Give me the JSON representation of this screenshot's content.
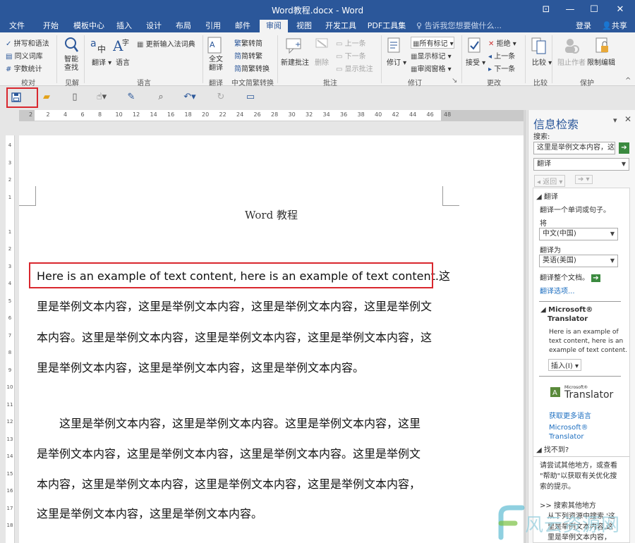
{
  "window": {
    "title": "Word教程.docx - Word",
    "controls": [
      "⊡",
      "—",
      "☐",
      "✕"
    ]
  },
  "menu": {
    "tabs": [
      "文件",
      "开始",
      "模板中心",
      "插入",
      "设计",
      "布局",
      "引用",
      "邮件",
      "审阅",
      "视图",
      "开发工具",
      "PDF工具集"
    ],
    "active_tab": "审阅",
    "tell_me": "告诉我您想要做什么...",
    "login": "登录",
    "share": "共享"
  },
  "ribbon": {
    "proofing": {
      "spelling": "拼写和语法",
      "thesaurus": "同义词库",
      "word_count": "字数统计",
      "group": "校对"
    },
    "insights": {
      "smart_lookup": [
        "智能",
        "查找"
      ],
      "group": "见解"
    },
    "language": {
      "translate": "翻译",
      "language": "语言",
      "update_ime": "更新输入法词典",
      "group": "语言"
    },
    "chinese_conversion": {
      "full_simplified": [
        "全文",
        "翻译"
      ],
      "to_simplified": "繁转简",
      "to_traditional": "简转繁",
      "convert": "简繁转换",
      "group": "翻译"
    },
    "conversion_group": "中文简繁转换",
    "comments": {
      "new": "新建批注",
      "delete": "删除",
      "previous": "上一条",
      "next": "下一条",
      "show": "显示批注",
      "group": "批注"
    },
    "tracking": {
      "track": "修订",
      "all_markup": "所有标记",
      "show_markup": "显示标记",
      "reviewing_pane": "审阅窗格",
      "group": "修订"
    },
    "changes": {
      "accept": "接受",
      "reject": "拒绝",
      "previous": "上一条",
      "next": "下一条",
      "group": "更改"
    },
    "compare": {
      "compare": "比较",
      "group": "比较"
    },
    "protect": {
      "block_authors": "阻止作者",
      "restrict": "限制编辑",
      "group": "保护"
    }
  },
  "accent_color": "#2b579a",
  "highlight_color": "#d9272e",
  "quick_access_icons": [
    "save-icon",
    "open-folder-icon",
    "new-doc-icon",
    "touch-mode-icon",
    "spelling-icon",
    "print-preview-icon",
    "undo-icon",
    "redo-icon",
    "customize-icon"
  ],
  "ruler": {
    "horizontal": [
      "2",
      "2",
      "4",
      "6",
      "8",
      "10",
      "12",
      "14",
      "16",
      "18",
      "20",
      "22",
      "24",
      "26",
      "28",
      "30",
      "32",
      "34",
      "36",
      "38",
      "40",
      "42",
      "44",
      "46",
      "48"
    ],
    "vertical": [
      "4",
      "3",
      "2",
      "1",
      "",
      "1",
      "2",
      "3",
      "4",
      "5",
      "6",
      "7",
      "8",
      "9",
      "10",
      "11",
      "12",
      "13",
      "14",
      "15",
      "16",
      "17",
      "18"
    ]
  },
  "document": {
    "title": "Word 教程",
    "paragraph1": [
      "Here is an example of text content, here is an example of text content.这",
      "里是举例文本内容，这里是举例文本内容，这里是举例文本内容，这里是举例文",
      "本内容。这里是举例文本内容，这里是举例文本内容，这里是举例文本内容，这",
      "里是举例文本内容，这里是举例文本内容，这里是举例文本内容。"
    ],
    "paragraph2": [
      "　　这里是举例文本内容，这里是举例文本内容。这里是举例文本内容，这里",
      "是举例文本内容，这里是举例文本内容，这里是举例文本内容。这里是举例文",
      "本内容，这里是举例文本内容，这里是举例文本内容，这里是举例文本内容，",
      "这里是举例文本内容，这里是举例文本内容。"
    ]
  },
  "research_pane": {
    "title": "信息检索",
    "search_label": "搜索:",
    "search_value": "这里是举例文本内容，这",
    "service": "翻译",
    "back": "返回",
    "section": "翻译",
    "translate_desc": "翻译一个单词或句子。",
    "from_label": "将",
    "from_value": "中文(中国)",
    "to_label": "翻译为",
    "to_value": "英语(美国)",
    "translate_doc": "翻译整个文档。",
    "translate_options": "翻译选项...",
    "ms_translator_heading": [
      "Microsoft®",
      "Translator"
    ],
    "result": [
      "Here is an example of",
      "text content, here is an",
      "example of text content."
    ],
    "insert": "插入(I)",
    "logo_small": "Microsoft®",
    "logo_text": "Translator",
    "more_languages": "获取更多语言",
    "ms_link": [
      "Microsoft®",
      "Translator"
    ],
    "not_found": "找不到?",
    "tips": [
      "请尝试其他地方，或查看",
      "\"帮助\"以获取有关优化搜",
      "索的提示。"
    ],
    "search_other": ">> 搜索其他地方",
    "search_from": [
      "从下列资源中搜索 '这",
      "里是举例文本内容,这",
      "里是举例文本内容，"
    ]
  },
  "watermark": {
    "text": "风云资源网"
  }
}
